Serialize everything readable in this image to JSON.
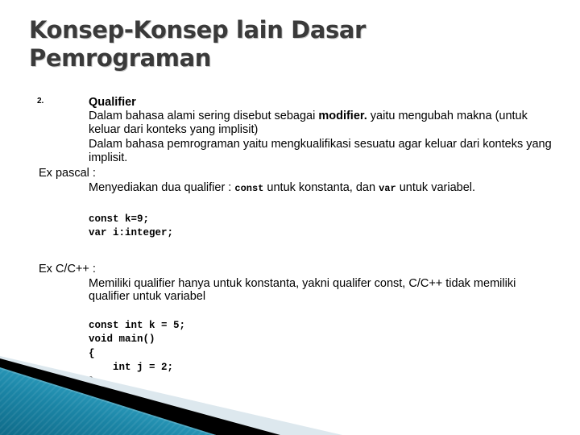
{
  "slide": {
    "title": "Konsep-Konsep lain Dasar Pemrograman",
    "bullet": {
      "number": "2.",
      "heading": "Qualifier"
    },
    "paragraphs": {
      "p1_before": "Dalam bahasa alami sering disebut sebagai ",
      "p1_bold": "modifier.",
      "p1_after": " yaitu mengubah makna (untuk keluar dari konteks yang implisit)",
      "p2": "Dalam bahasa pemrograman yaitu mengkualifikasi sesuatu agar keluar dari konteks yang implisit."
    },
    "pascal": {
      "label": "Ex pascal :",
      "desc_1": "Menyediakan dua qualifier : ",
      "desc_kw1": "const",
      "desc_2": " untuk konstanta, dan ",
      "desc_kw2": "var",
      "desc_3": " untuk variabel.",
      "code": "const k=9;\nvar i:integer;"
    },
    "cpp": {
      "label": "Ex C/C++ :",
      "desc": "Memiliki qualifier hanya untuk konstanta, yakni qualifer const, C/C++ tidak memiliki qualifier untuk variabel",
      "code": "const int k = 5;\nvoid main()\n{\n    int j = 2;\n}"
    }
  },
  "decoration": {
    "name": "bottom-left-diagonal-banner",
    "colors": {
      "teal_dark": "#11708f",
      "teal_mid": "#2794b5",
      "teal_light": "#58bcd9",
      "black_stripe": "#000000",
      "pale_blue": "#dde8ee",
      "background": "#ffffff"
    }
  },
  "theme": {
    "title_color": "#3a3a3a",
    "body_color": "#000000",
    "page_background": "#ffffff"
  }
}
